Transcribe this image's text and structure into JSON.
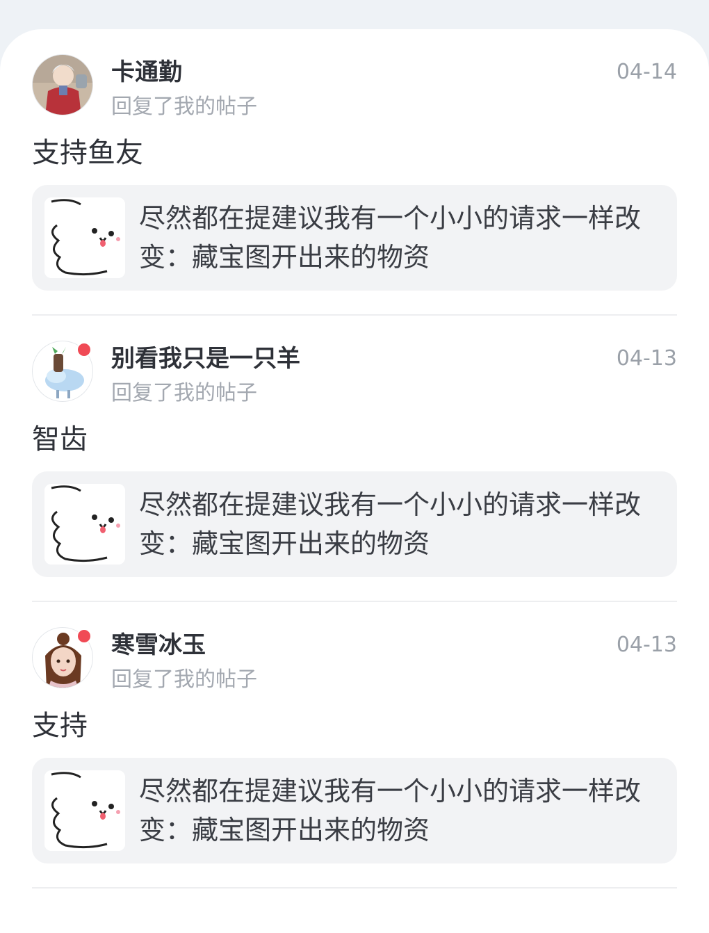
{
  "notifications": [
    {
      "user": "卡通勤",
      "date": "04-14",
      "action": "回复了我的帖子",
      "reply": "支持鱼友",
      "quote": "尽然都在提建议我有一个小小的请求一样改变：藏宝图开出来的物资",
      "unread": false
    },
    {
      "user": "别看我只是一只羊",
      "date": "04-13",
      "action": "回复了我的帖子",
      "reply": "智齿",
      "quote": "尽然都在提建议我有一个小小的请求一样改变：藏宝图开出来的物资",
      "unread": true
    },
    {
      "user": "寒雪冰玉",
      "date": "04-13",
      "action": "回复了我的帖子",
      "reply": "支持",
      "quote": "尽然都在提建议我有一个小小的请求一样改变：藏宝图开出来的物资",
      "unread": true
    }
  ],
  "colors": {
    "background": "#eef2f6",
    "unread_dot": "#f04a55",
    "quote_bg": "#f2f3f5"
  }
}
